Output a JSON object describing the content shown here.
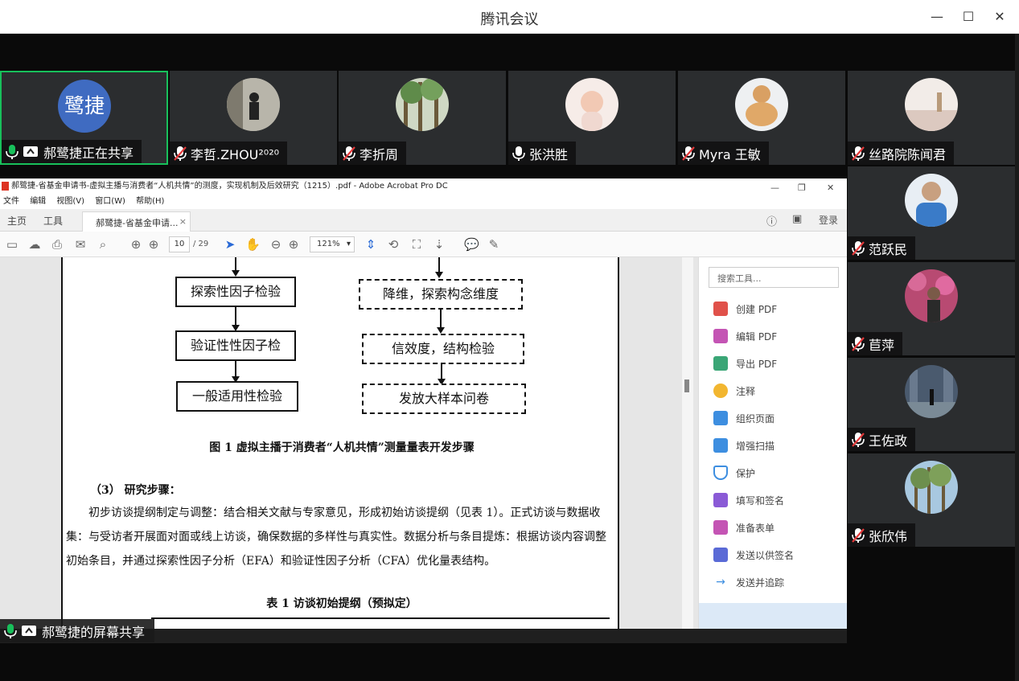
{
  "window": {
    "title": "腾讯会议",
    "minimize_icon": "minimize-icon",
    "maximize_icon": "maximize-icon",
    "close_icon": "close-icon"
  },
  "participants_top": [
    {
      "name": "郝鹭捷正在共享",
      "avatar_text": "鹭捷",
      "mic": "on",
      "sharing": true,
      "active": true
    },
    {
      "name": "李哲.ZHOU²⁰²⁰",
      "mic": "muted",
      "avatar_color": "#9c9a8f"
    },
    {
      "name": "李折周",
      "mic": "muted",
      "avatar_color": "#6f8f5a"
    },
    {
      "name": "张洪胜",
      "mic": "on",
      "avatar_color": "#f0d8d0"
    },
    {
      "name": "Myra 王敏",
      "mic": "muted",
      "avatar_color": "#d9a063"
    },
    {
      "name": "丝路院陈闻君",
      "mic": "muted",
      "avatar_color": "#e6d7cf"
    }
  ],
  "participants_side": [
    {
      "name": "范跃民",
      "mic": "muted",
      "avatar_color": "#3a7bc8"
    },
    {
      "name": "苣萍",
      "mic": "muted",
      "avatar_color": "#b84a72"
    },
    {
      "name": "王佐政",
      "mic": "muted",
      "avatar_color": "#4a5a6e"
    },
    {
      "name": "张欣伟",
      "mic": "muted",
      "avatar_color": "#6d8f4e"
    }
  ],
  "acrobat": {
    "title": "郝鹭捷-省基金申请书-虚拟主播与消费者“人机共情”的测度，实现机制及后效研究（1215）.pdf - Adobe Acrobat Pro DC",
    "menu": [
      "文件",
      "编辑",
      "视图(V)",
      "窗口(W)",
      "帮助(H)"
    ],
    "tabs": {
      "home": "主页",
      "tools": "工具",
      "doc": "郝鹭捷-省基金申请...",
      "login": "登录"
    },
    "page_current": "10",
    "page_total": "/ 29",
    "zoom": "121%",
    "search_placeholder": "搜索工具...",
    "tools_list": [
      {
        "label": "创建 PDF",
        "color": "#e0514a"
      },
      {
        "label": "编辑 PDF",
        "color": "#c454b4"
      },
      {
        "label": "导出 PDF",
        "color": "#3aa676"
      },
      {
        "label": "注释",
        "color": "#f2b630"
      },
      {
        "label": "组织页面",
        "color": "#3d8ee0"
      },
      {
        "label": "增强扫描",
        "color": "#3d8ee0"
      },
      {
        "label": "保护",
        "color": "#3d8ee0"
      },
      {
        "label": "填写和签名",
        "color": "#8a5ad6"
      },
      {
        "label": "准备表单",
        "color": "#c454b4"
      },
      {
        "label": "发送以供签名",
        "color": "#5a6ad6"
      },
      {
        "label": "发送并追踪",
        "color": "#3d8ee0"
      }
    ]
  },
  "document": {
    "left_boxes": [
      "探索性因子检验",
      "验证性性因子检",
      "一般适用性检验"
    ],
    "right_boxes": [
      "降维，探索构念维度",
      "信效度，结构检验",
      "发放大样本问卷"
    ],
    "figure_caption": "图 1 虚拟主播于消费者“人机共情”测量量表开发步骤",
    "section_heading": "（3）  研究步骤：",
    "paragraph": "初步访谈提纲制定与调整：结合相关文献与专家意见，形成初始访谈提纲（见表 1）。正式访谈与数据收集：与受访者开展面对面或线上访谈，确保数据的多样性与真实性。数据分析与条目提炼：根据访谈内容调整初始条目，并通过探索性因子分析（EFA）和验证性因子分析（CFA）优化量表结构。",
    "table_caption": "表 1 访谈初始提纲（预拟定）"
  },
  "screen_share_label": "郝鹭捷的屏幕共享"
}
